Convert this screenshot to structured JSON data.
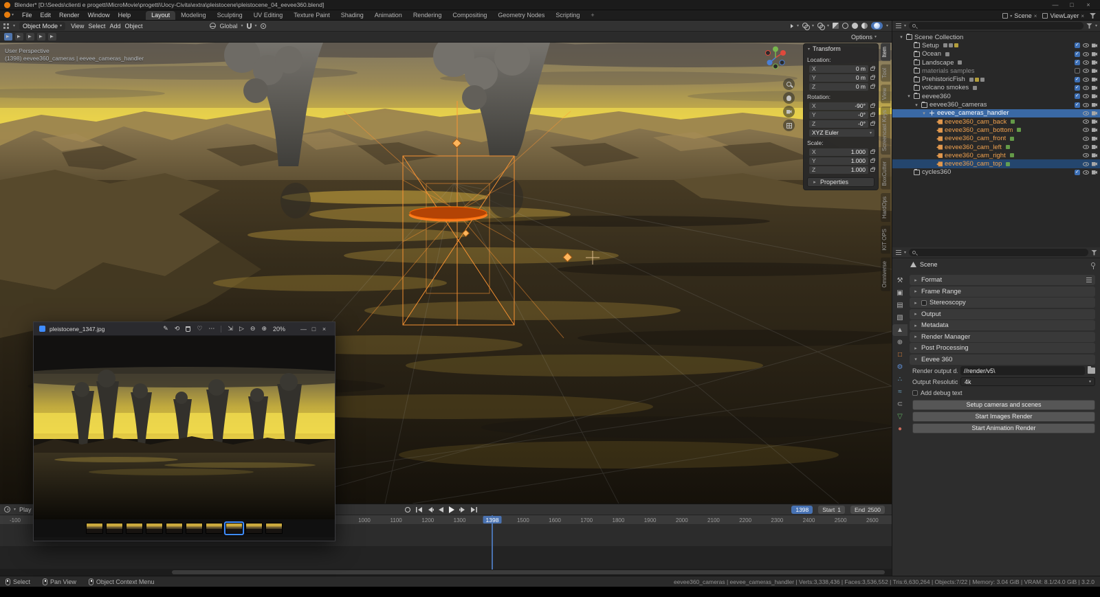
{
  "titlebar": {
    "title": "Blender* [D:\\Seeds\\clienti e progetti\\MicroMovie\\progetti\\Uocy-Civita\\extra\\pleistocene\\pleistocene_04_eevee360.blend]"
  },
  "topbar": {
    "menus": [
      {
        "label": "File"
      },
      {
        "label": "Edit"
      },
      {
        "label": "Render"
      },
      {
        "label": "Window"
      },
      {
        "label": "Help"
      }
    ],
    "workspaces": [
      {
        "label": "Layout",
        "cls": "active"
      },
      {
        "label": "Modeling"
      },
      {
        "label": "Sculpting"
      },
      {
        "label": "UV Editing"
      },
      {
        "label": "Texture Paint"
      },
      {
        "label": "Shading"
      },
      {
        "label": "Animation"
      },
      {
        "label": "Rendering"
      },
      {
        "label": "Compositing"
      },
      {
        "label": "Geometry Nodes"
      },
      {
        "label": "Scripting"
      },
      {
        "label": "+",
        "cls": "add"
      }
    ],
    "scene_name": "Scene",
    "viewlayer_name": "ViewLayer"
  },
  "viewport": {
    "mode": "Object Mode",
    "menus": [
      {
        "label": "View"
      },
      {
        "label": "Select"
      },
      {
        "label": "Add"
      },
      {
        "label": "Object"
      }
    ],
    "orientation": "Global",
    "options_label": "Options",
    "overlay_perspective": "User Perspective",
    "overlay_context": "(1398) eevee360_cameras | eevee_cameras_handler",
    "side_tabs": [
      {
        "label": "Item",
        "cls": "active"
      },
      {
        "label": "Tool"
      },
      {
        "label": "View"
      },
      {
        "label": "Screencast Keys"
      },
      {
        "label": "BoxCutter"
      },
      {
        "label": "HardOps"
      },
      {
        "label": "KIT OPS"
      },
      {
        "label": "Omniverse"
      }
    ]
  },
  "transform": {
    "title": "Transform",
    "rows": [
      {
        "cls": "sect",
        "label": "Location:"
      },
      {
        "cls": "field",
        "axis": "X",
        "value": "0 m"
      },
      {
        "cls": "field",
        "axis": "Y",
        "value": "0 m"
      },
      {
        "cls": "field",
        "axis": "Z",
        "value": "0 m"
      },
      {
        "cls": "sect",
        "label": "Rotation:"
      },
      {
        "cls": "field",
        "axis": "X",
        "value": "-90°"
      },
      {
        "cls": "field",
        "axis": "Y",
        "value": "-0°"
      },
      {
        "cls": "field",
        "axis": "Z",
        "value": "-0°"
      },
      {
        "cls": "drop",
        "value": "XYZ Euler"
      },
      {
        "cls": "sect",
        "label": "Scale:"
      },
      {
        "cls": "field",
        "axis": "X",
        "value": "1.000"
      },
      {
        "cls": "field",
        "axis": "Y",
        "value": "1.000"
      },
      {
        "cls": "field",
        "axis": "Z",
        "value": "1.000"
      }
    ],
    "properties_label": "Properties"
  },
  "outliner": {
    "rows": [
      {
        "label": "Scene Collection",
        "level": 0,
        "icon": "collection",
        "disc": "open",
        "cls": "root"
      },
      {
        "label": "Setup",
        "level": 1,
        "icon": "collection",
        "chk": "true",
        "extra": [
          "tool",
          "camera",
          "light"
        ]
      },
      {
        "label": "Ocean",
        "level": 1,
        "icon": "collection",
        "chk": "true",
        "extra": [
          "modifier"
        ]
      },
      {
        "label": "Landscape",
        "level": 1,
        "icon": "collection",
        "chk": "true",
        "extra": [
          "geometry"
        ]
      },
      {
        "label": "materials samples",
        "level": 1,
        "icon": "collection",
        "chk": "false",
        "cls": "dim"
      },
      {
        "label": "PrehistoricFish",
        "level": 1,
        "icon": "collection",
        "chk": "true",
        "extra": [
          "armature",
          "light",
          "constraint"
        ]
      },
      {
        "label": "volcano smokes",
        "level": 1,
        "icon": "collection",
        "chk": "true",
        "extra": [
          "particles"
        ]
      },
      {
        "label": "eevee360",
        "level": 1,
        "icon": "collection",
        "disc": "open",
        "chk": "true"
      },
      {
        "label": "eevee360_cameras",
        "level": 2,
        "icon": "collection",
        "disc": "open",
        "chk": "true"
      },
      {
        "label": "eevee_cameras_handler",
        "level": 3,
        "icon": "empty",
        "disc": "open",
        "cls": "selected"
      },
      {
        "label": "eevee360_cam_back",
        "level": 4,
        "icon": "camera",
        "cls": "orange",
        "extra": [
          "camera-data"
        ]
      },
      {
        "label": "eevee360_cam_bottom",
        "level": 4,
        "icon": "camera",
        "cls": "orange",
        "extra": [
          "camera-data"
        ]
      },
      {
        "label": "eevee360_cam_front",
        "level": 4,
        "icon": "camera",
        "cls": "orange",
        "extra": [
          "camera-data"
        ]
      },
      {
        "label": "eevee360_cam_left",
        "level": 4,
        "icon": "camera",
        "cls": "orange",
        "extra": [
          "camera-data"
        ]
      },
      {
        "label": "eevee360_cam_right",
        "level": 4,
        "icon": "camera",
        "cls": "orange",
        "extra": [
          "camera-data"
        ]
      },
      {
        "label": "eevee360_cam_top",
        "level": 4,
        "icon": "camera",
        "cls": "orange sel2",
        "extra": [
          "camera-data"
        ]
      },
      {
        "label": "cycles360",
        "level": 1,
        "icon": "collection",
        "chk": "true"
      }
    ]
  },
  "properties": {
    "breadcrumb": "Scene",
    "sections": [
      {
        "label": "Format",
        "disc": "closed",
        "cls": "has-preset"
      },
      {
        "label": "Frame Range",
        "disc": "closed"
      },
      {
        "label": "Stereoscopy",
        "disc": "closed",
        "chk": "false"
      },
      {
        "label": "Output",
        "disc": "closed"
      },
      {
        "label": "Metadata",
        "disc": "closed"
      },
      {
        "label": "Render Manager",
        "disc": "closed"
      },
      {
        "label": "Post Processing",
        "disc": "closed"
      },
      {
        "label": "Eevee 360",
        "disc": "open"
      }
    ],
    "eevee": {
      "output_label": "Render output d...",
      "output_value": "//render/v5\\",
      "resolution_label": "Output Resolutio",
      "resolution_value": "4k",
      "debug_label": "Add debug text",
      "buttons": [
        {
          "label": "Setup cameras and scenes"
        },
        {
          "label": "Start Images Render"
        },
        {
          "label": "Start Animation Render"
        }
      ]
    },
    "tabs": [
      {
        "icon": "tool"
      },
      {
        "icon": "render"
      },
      {
        "icon": "output"
      },
      {
        "icon": "view-layer"
      },
      {
        "icon": "scene",
        "cls": "active"
      },
      {
        "icon": "world"
      },
      {
        "icon": "object",
        "cls": "c-orange"
      },
      {
        "icon": "modifiers",
        "cls": "c-blue"
      },
      {
        "icon": "particles",
        "cls": "c-lblue"
      },
      {
        "icon": "physics",
        "cls": "c-lblue"
      },
      {
        "icon": "constraints"
      },
      {
        "icon": "object-data",
        "cls": "c-green"
      },
      {
        "icon": "material",
        "cls": "c-red"
      }
    ]
  },
  "photos": {
    "title": "pleistocene_1347.jpg",
    "zoom_level": "20%",
    "thumbs": [
      {},
      {},
      {},
      {},
      {},
      {},
      {},
      {
        "cls": "sel"
      },
      {},
      {}
    ]
  },
  "timeline": {
    "menu_label": "Play",
    "current_frame": "1398",
    "start_label": "Start",
    "start_value": "1",
    "end_label": "End",
    "end_value": "2500",
    "playhead": "1398",
    "ruler": [
      {
        "frame": "-100"
      },
      {
        "frame": "1000"
      },
      {
        "frame": "1100"
      },
      {
        "frame": "1200"
      },
      {
        "frame": "1300"
      },
      {
        "frame": "1500"
      },
      {
        "frame": "1600"
      },
      {
        "frame": "1700"
      },
      {
        "frame": "1800"
      },
      {
        "frame": "1900"
      },
      {
        "frame": "2000"
      },
      {
        "frame": "2100"
      },
      {
        "frame": "2200"
      },
      {
        "frame": "2300"
      },
      {
        "frame": "2400"
      },
      {
        "frame": "2500"
      },
      {
        "frame": "2600"
      }
    ]
  },
  "statusbar": {
    "hints": [
      {
        "icon": "mouse-left",
        "label": "Select"
      },
      {
        "icon": "mouse-middle",
        "label": "Pan View"
      },
      {
        "icon": "mouse-right",
        "label": "Object Context Menu"
      }
    ],
    "info": "eevee360_cameras | eevee_cameras_handler | Verts:3,338,436 | Faces:3,536,552 | Tris:6,630,264 | Objects:7/22 | Memory: 3.04 GiB | VRAM: 8.1/24.0 GiB | 3.2.0"
  }
}
